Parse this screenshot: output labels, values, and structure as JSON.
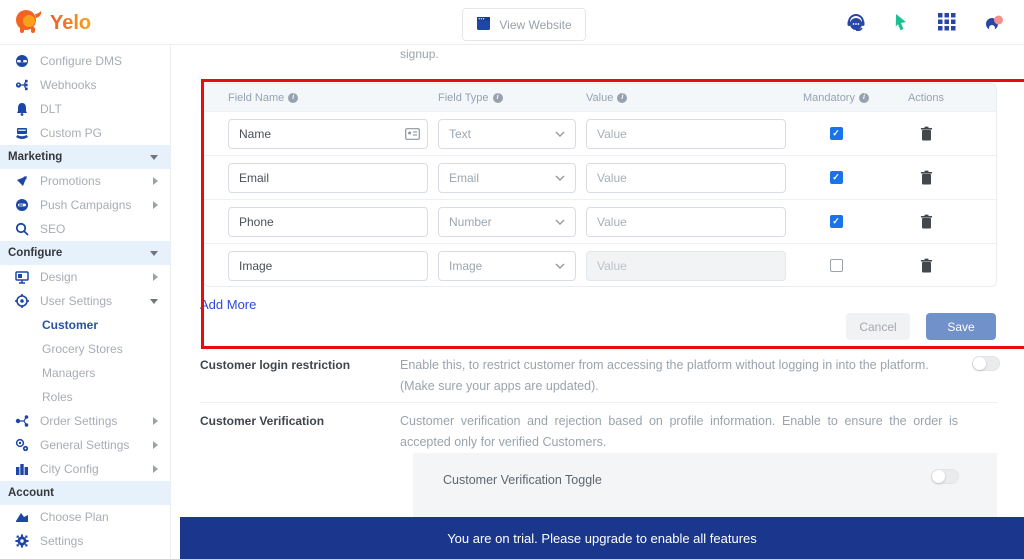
{
  "brand": {
    "name": "Yelo"
  },
  "header": {
    "view_website_label": "View Website",
    "icons": [
      "support-icon",
      "pointer-icon",
      "apps-grid-icon",
      "profile-icon"
    ]
  },
  "sidebar": {
    "items": [
      {
        "label": "Configure DMS",
        "icon": "dms-icon",
        "kind": "item",
        "arrow": "none"
      },
      {
        "label": "Webhooks",
        "icon": "webhooks-icon",
        "kind": "item",
        "arrow": "none"
      },
      {
        "label": "DLT",
        "icon": "bell-icon",
        "kind": "item",
        "arrow": "none"
      },
      {
        "label": "Custom PG",
        "icon": "custom-pg-icon",
        "kind": "item",
        "arrow": "none"
      },
      {
        "label": "Marketing",
        "kind": "section",
        "arrow": "down"
      },
      {
        "label": "Promotions",
        "icon": "promotions-icon",
        "kind": "item",
        "arrow": "right"
      },
      {
        "label": "Push Campaigns",
        "icon": "push-campaigns-icon",
        "kind": "item",
        "arrow": "right"
      },
      {
        "label": "SEO",
        "icon": "seo-icon",
        "kind": "item",
        "arrow": "none"
      },
      {
        "label": "Configure",
        "kind": "section",
        "arrow": "down"
      },
      {
        "label": "Design",
        "icon": "design-icon",
        "kind": "item",
        "arrow": "right"
      },
      {
        "label": "User Settings",
        "icon": "user-settings-icon",
        "kind": "item",
        "arrow": "down"
      },
      {
        "label": "Customer",
        "kind": "sub",
        "active": true
      },
      {
        "label": "Grocery Stores",
        "kind": "sub",
        "active": false
      },
      {
        "label": "Managers",
        "kind": "sub",
        "active": false
      },
      {
        "label": "Roles",
        "kind": "sub",
        "active": false
      },
      {
        "label": "Order Settings",
        "icon": "order-settings-icon",
        "kind": "item",
        "arrow": "right"
      },
      {
        "label": "General Settings",
        "icon": "general-settings-icon",
        "kind": "item",
        "arrow": "right"
      },
      {
        "label": "City Config",
        "icon": "city-config-icon",
        "kind": "item",
        "arrow": "right"
      },
      {
        "label": "Account",
        "kind": "section",
        "arrow": "none"
      },
      {
        "label": "Choose Plan",
        "icon": "choose-plan-icon",
        "kind": "item",
        "arrow": "none"
      },
      {
        "label": "Settings",
        "icon": "settings-icon",
        "kind": "item",
        "arrow": "none"
      }
    ]
  },
  "content": {
    "scrolled_text": "signup.",
    "table": {
      "headers": {
        "field_name": "Field Name",
        "field_type": "Field Type",
        "value": "Value",
        "mandatory": "Mandatory",
        "actions": "Actions"
      },
      "rows": [
        {
          "field_name": "Name",
          "field_type": "Text",
          "value_placeholder": "Value",
          "mandatory": true,
          "value_disabled": false
        },
        {
          "field_name": "Email",
          "field_type": "Email",
          "value_placeholder": "Value",
          "mandatory": true,
          "value_disabled": false
        },
        {
          "field_name": "Phone",
          "field_type": "Number",
          "value_placeholder": "Value",
          "mandatory": true,
          "value_disabled": false
        },
        {
          "field_name": "Image",
          "field_type": "Image",
          "value_placeholder": "Value",
          "mandatory": false,
          "value_disabled": true
        }
      ],
      "add_more_label": "Add More",
      "cancel_label": "Cancel",
      "save_label": "Save"
    },
    "sections": [
      {
        "title": "Customer login restriction",
        "description": "Enable this, to restrict customer from accessing the platform without logging in into the platform.",
        "description2": "(Make sure your apps are updated).",
        "toggle_on": false
      },
      {
        "title": "Customer Verification",
        "description": "Customer verification and rejection based on profile information. Enable to ensure the order is accepted only for verified Customers.",
        "inner_label": "Customer Verification Toggle",
        "toggle_on": false
      }
    ]
  },
  "banner": {
    "text": "You are on trial. Please upgrade to enable all features"
  },
  "colors": {
    "sidebar_icon_blue": "#1d46a5",
    "active_link": "#2b51a3",
    "checkbox_blue": "#1a73e8",
    "save_button": "#7191cb",
    "add_more_link": "#2a4bd7",
    "banner_blue": "#1a378d",
    "highlight_red": "#ea0b0b",
    "pointer_green": "#1fbf92"
  }
}
